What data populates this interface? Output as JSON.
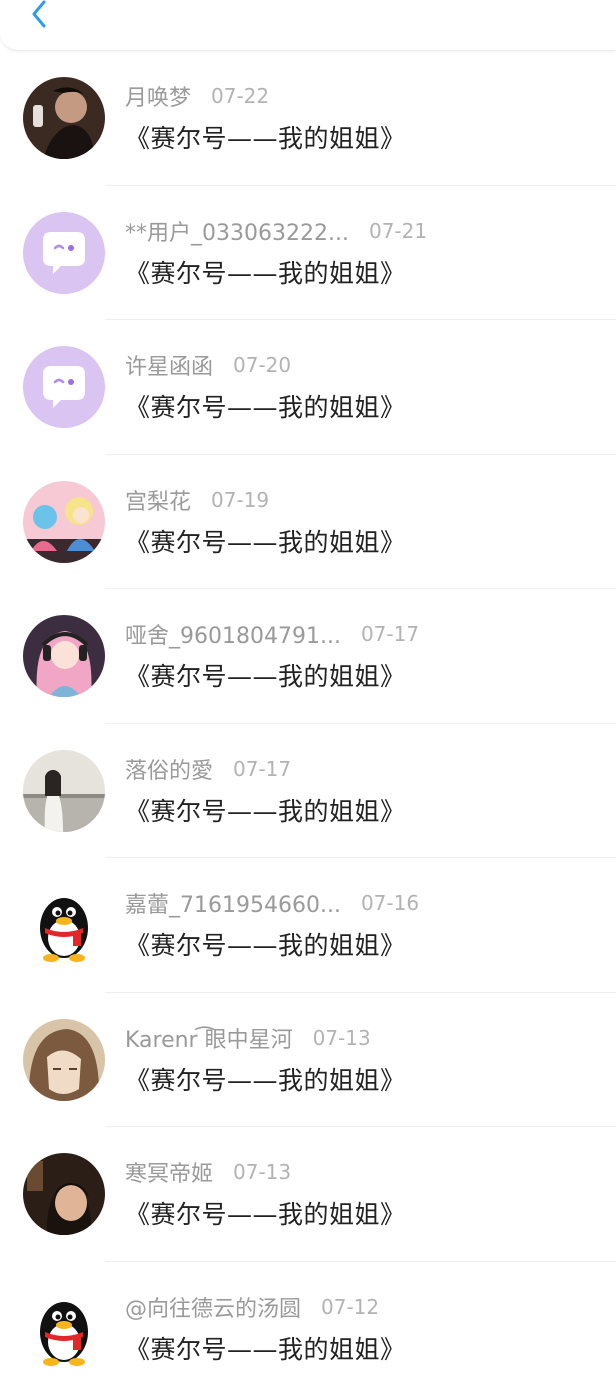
{
  "header": {
    "back_icon": "chevron-left-icon",
    "accent": "#2f9bf0"
  },
  "items": [
    {
      "name": "月唤梦",
      "date": "07-22",
      "title": "《赛尔号——我的姐姐》",
      "avatar": "photo"
    },
    {
      "name": "**用户_033063222...",
      "date": "07-21",
      "title": "《赛尔号——我的姐姐》",
      "avatar": "default-chat-bubble"
    },
    {
      "name": "许星函函",
      "date": "07-20",
      "title": "《赛尔号——我的姐姐》",
      "avatar": "default-chat-bubble"
    },
    {
      "name": "宫梨花",
      "date": "07-19",
      "title": "《赛尔号——我的姐姐》",
      "avatar": "anime"
    },
    {
      "name": "哑舍_9601804791...",
      "date": "07-17",
      "title": "《赛尔号——我的姐姐》",
      "avatar": "anime"
    },
    {
      "name": "落俗的愛",
      "date": "07-17",
      "title": "《赛尔号——我的姐姐》",
      "avatar": "photo"
    },
    {
      "name": "嘉蕾_7161954660...",
      "date": "07-16",
      "title": "《赛尔号——我的姐姐》",
      "avatar": "qq-penguin"
    },
    {
      "name": "Karenr ͡眼中星河",
      "date": "07-13",
      "title": "《赛尔号——我的姐姐》",
      "avatar": "anime"
    },
    {
      "name": "寒冥帝姬",
      "date": "07-13",
      "title": "《赛尔号——我的姐姐》",
      "avatar": "photo"
    },
    {
      "name": "@向往德云的汤圆",
      "date": "07-12",
      "title": "《赛尔号——我的姐姐》",
      "avatar": "qq-penguin"
    }
  ]
}
